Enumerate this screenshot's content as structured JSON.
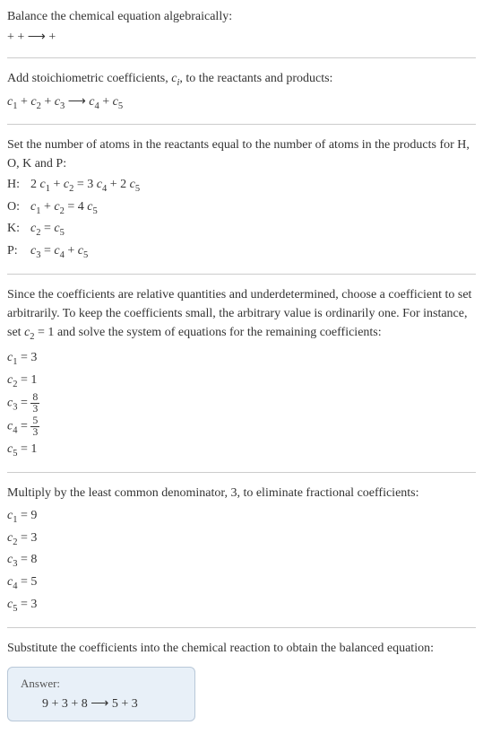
{
  "intro": {
    "line1": "Balance the chemical equation algebraically:",
    "line2_parts": [
      " + ",
      " + ",
      " ⟶ ",
      " + "
    ]
  },
  "stoich": {
    "line1": "Add stoichiometric coefficients, ",
    "ci": "c",
    "ci_sub": "i",
    "line1_end": ", to the reactants and products:",
    "eq_c1": "c",
    "eq_c1_sub": "1",
    "eq_c2": "c",
    "eq_c2_sub": "2",
    "eq_c3": "c",
    "eq_c3_sub": "3",
    "eq_c4": "c",
    "eq_c4_sub": "4",
    "eq_c5": "c",
    "eq_c5_sub": "5",
    "plus": " + ",
    "arrow": " ⟶ "
  },
  "atoms": {
    "intro1": "Set the number of atoms in the reactants equal to the number of atoms in the products for H, O, K and P:",
    "rows": [
      {
        "label": "H:",
        "lhs_pre": "2 ",
        "c1": "c",
        "c1s": "1",
        "mid1": " + ",
        "c2": "c",
        "c2s": "2",
        "eq": " = 3 ",
        "c4": "c",
        "c4s": "4",
        "mid2": " + 2 ",
        "c5": "c",
        "c5s": "5"
      },
      {
        "label": "O:",
        "lhs_pre": "",
        "c1": "c",
        "c1s": "1",
        "mid1": " + ",
        "c2": "c",
        "c2s": "2",
        "eq": " = 4 ",
        "c4": "",
        "c4s": "",
        "mid2": "",
        "c5": "c",
        "c5s": "5"
      },
      {
        "label": "K:",
        "lhs_pre": "",
        "c1": "c",
        "c1s": "2",
        "mid1": "",
        "c2": "",
        "c2s": "",
        "eq": " = ",
        "c4": "",
        "c4s": "",
        "mid2": "",
        "c5": "c",
        "c5s": "5"
      },
      {
        "label": "P:",
        "lhs_pre": "",
        "c1": "c",
        "c1s": "3",
        "mid1": "",
        "c2": "",
        "c2s": "",
        "eq": " = ",
        "c4": "c",
        "c4s": "4",
        "mid2": " + ",
        "c5": "c",
        "c5s": "5"
      }
    ]
  },
  "solve": {
    "intro": "Since the coefficients are relative quantities and underdetermined, choose a coefficient to set arbitrarily. To keep the coefficients small, the arbitrary value is ordinarily one. For instance, set ",
    "setc": "c",
    "setc_sub": "2",
    "seteq": " = 1",
    "intro_end": " and solve the system of equations for the remaining coefficients:",
    "coeffs": [
      {
        "c": "c",
        "s": "1",
        "eq": " = ",
        "val": "3",
        "frac_num": "",
        "frac_den": ""
      },
      {
        "c": "c",
        "s": "2",
        "eq": " = ",
        "val": "1",
        "frac_num": "",
        "frac_den": ""
      },
      {
        "c": "c",
        "s": "3",
        "eq": " = ",
        "val": "",
        "frac_num": "8",
        "frac_den": "3"
      },
      {
        "c": "c",
        "s": "4",
        "eq": " = ",
        "val": "",
        "frac_num": "5",
        "frac_den": "3"
      },
      {
        "c": "c",
        "s": "5",
        "eq": " = ",
        "val": "1",
        "frac_num": "",
        "frac_den": ""
      }
    ]
  },
  "mult": {
    "intro": "Multiply by the least common denominator, 3, to eliminate fractional coefficients:",
    "coeffs": [
      {
        "c": "c",
        "s": "1",
        "eq": " = ",
        "val": "9"
      },
      {
        "c": "c",
        "s": "2",
        "eq": " = ",
        "val": "3"
      },
      {
        "c": "c",
        "s": "3",
        "eq": " = ",
        "val": "8"
      },
      {
        "c": "c",
        "s": "4",
        "eq": " = ",
        "val": "5"
      },
      {
        "c": "c",
        "s": "5",
        "eq": " = ",
        "val": "3"
      }
    ]
  },
  "final": {
    "intro": "Substitute the coefficients into the chemical reaction to obtain the balanced equation:",
    "answer_label": "Answer:",
    "eq": "9  + 3  + 8  ⟶ 5  + 3 "
  }
}
